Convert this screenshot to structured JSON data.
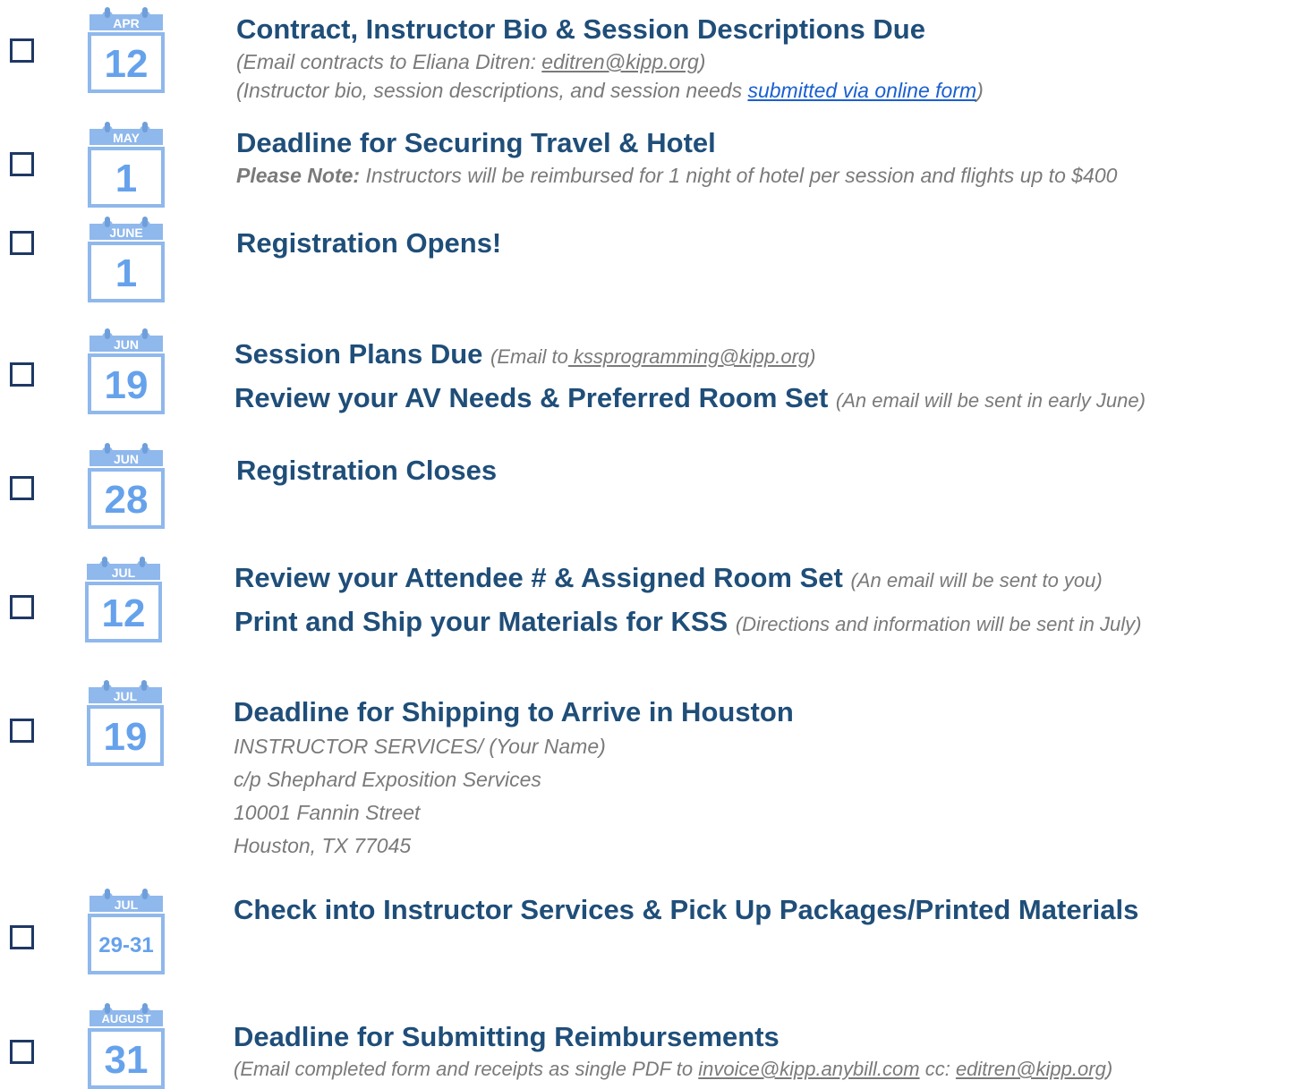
{
  "items": [
    {
      "month": "APR",
      "day": "12",
      "title": "Contract, Instructor Bio & Session Descriptions Due",
      "note1_prefix": "(Email contracts to Eliana Ditren: ",
      "note1_link": "editren@kipp.org",
      "note1_suffix": ")",
      "note2_prefix": "(Instructor bio, session descriptions, and session needs ",
      "note2_link": "submitted via online form",
      "note2_suffix": ")"
    },
    {
      "month": "MAY",
      "day": "1",
      "title": "Deadline for Securing Travel & Hotel",
      "note_bold": "Please Note:",
      "note_rest": " Instructors will be reimbursed for 1 night of hotel per session and flights up to $400"
    },
    {
      "month": "JUNE",
      "day": "1",
      "title": "Registration Opens!"
    },
    {
      "month": "JUN",
      "day": "19",
      "title1": "Session Plans Due",
      "title1_note_prefix": "(Email to",
      "title1_note_link": " kssprogramming@kipp.org",
      "title1_note_suffix": ")",
      "title2": "Review your AV Needs & Preferred Room Set",
      "title2_note": "(An email will be sent in early June)"
    },
    {
      "month": "JUN",
      "day": "28",
      "title": "Registration Closes"
    },
    {
      "month": "JUL",
      "day": "12",
      "title1": "Review your Attendee # & Assigned Room Set",
      "title1_note": "(An email will be sent to you)",
      "title2": "Print and Ship your Materials for KSS",
      "title2_note": "(Directions and information will be sent in July)"
    },
    {
      "month": "JUL",
      "day": "19",
      "title": "Deadline for Shipping to Arrive in Houston",
      "address": [
        "INSTRUCTOR SERVICES/ (Your Name)",
        "c/p Shephard Exposition Services",
        "10001 Fannin Street",
        "Houston, TX 77045"
      ]
    },
    {
      "month": "JUL",
      "day": "29-31",
      "title": "Check into Instructor Services & Pick Up Packages/Printed Materials"
    },
    {
      "month": "AUGUST",
      "day": "31",
      "title": "Deadline for Submitting Reimbursements",
      "note_prefix": "(Email completed form and receipts as single PDF to ",
      "note_link1": "invoice@kipp.anybill.com",
      "note_mid": " cc: ",
      "note_link2": "editren@kipp.org",
      "note_suffix": ")"
    }
  ]
}
